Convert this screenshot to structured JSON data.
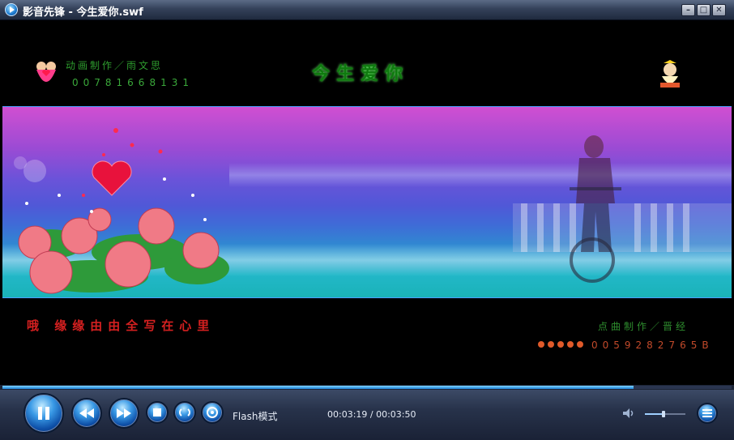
{
  "window": {
    "title": "影音先锋 - 今生爱你.swf"
  },
  "video": {
    "title_text": "今生爱你",
    "top_credit": "动画制作／雨文思",
    "top_phone": "00781668131",
    "bottom_lyric": "哦 缘缘由由全写在心里",
    "bottom_credit": "点曲制作／晋经",
    "bottom_phone": "0059282765B"
  },
  "controls": {
    "mode_label": "Flash模式",
    "time_label": "00:03:19 / 00:03:50",
    "progress_fraction": 0.866,
    "volume_fraction": 0.45
  },
  "colors": {
    "accent": "#1d7fd8",
    "title_green": "#0f7a0f",
    "lyric_red": "#d42020"
  },
  "icons": [
    "app-logo-icon",
    "minimize-icon",
    "maximize-icon",
    "close-icon",
    "pause-icon",
    "rewind-icon",
    "fast-forward-icon",
    "stop-icon",
    "repeat-icon",
    "open-file-icon",
    "volume-icon",
    "playlist-icon"
  ]
}
